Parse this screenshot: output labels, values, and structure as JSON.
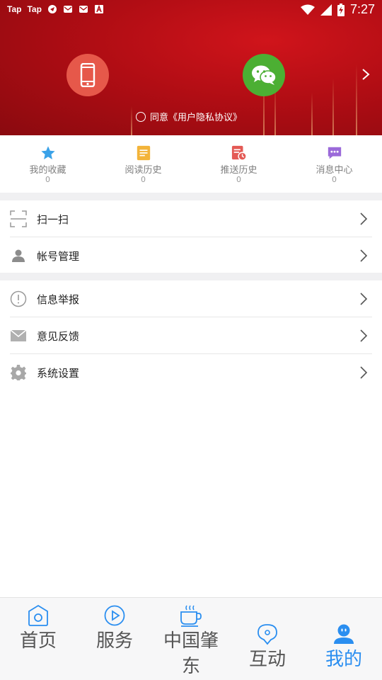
{
  "status_bar": {
    "left_items": [
      "Tap",
      "Tap"
    ],
    "time": "7:27"
  },
  "header": {
    "login_options": [
      {
        "name": "phone-login",
        "icon": "phone-icon",
        "color": "#e6584a"
      },
      {
        "name": "wechat-login",
        "icon": "wechat-icon",
        "color": "#4caf33"
      }
    ],
    "agreement_text": "同意《用户隐私协议》",
    "more_icon": "chevron-right-icon"
  },
  "quick_links": [
    {
      "label": "我的收藏",
      "count": "0",
      "icon": "star-icon",
      "color": "#3aa2e8"
    },
    {
      "label": "阅读历史",
      "count": "0",
      "icon": "document-icon",
      "color": "#f3b43a"
    },
    {
      "label": "推送历史",
      "count": "0",
      "icon": "history-icon",
      "color": "#e45a55"
    },
    {
      "label": "消息中心",
      "count": "0",
      "icon": "message-icon",
      "color": "#9b6ad9"
    }
  ],
  "menu_groups": [
    [
      {
        "label": "扫一扫",
        "icon": "scan-icon"
      },
      {
        "label": "帐号管理",
        "icon": "user-icon"
      }
    ],
    [
      {
        "label": "信息举报",
        "icon": "alert-icon"
      },
      {
        "label": "意见反馈",
        "icon": "mail-icon"
      },
      {
        "label": "系统设置",
        "icon": "gear-icon"
      }
    ]
  ],
  "bottom_nav": [
    {
      "label": "首页",
      "icon": "home-icon"
    },
    {
      "label": "服务",
      "icon": "play-icon"
    },
    {
      "label": "中国肇东",
      "icon": "coffee-icon"
    },
    {
      "label": "互动",
      "icon": "chat-pin-icon"
    },
    {
      "label": "我的",
      "icon": "profile-icon",
      "active": true
    }
  ],
  "colors": {
    "header_red": "#b10d14",
    "accent_blue": "#2a8ef0",
    "separator": "#f0f0f2"
  }
}
